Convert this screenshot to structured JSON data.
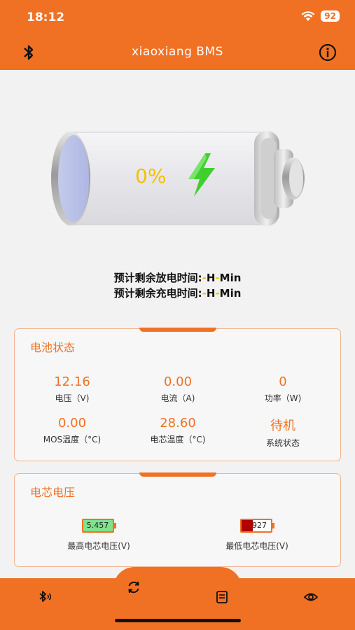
{
  "status": {
    "time": "18:12",
    "battery": "92"
  },
  "header": {
    "title": "xiaoxiang BMS",
    "bt_icon": "bluetooth-icon",
    "info_icon": "info-icon"
  },
  "battery": {
    "percent": "0%",
    "bolt_icon": "lightning-bolt-icon"
  },
  "remaining": {
    "discharge_label": "预计剩余放电时间:",
    "charge_label": "预计剩余充电时间:",
    "h": "H",
    "min": "Min",
    "dash": "-"
  },
  "status_card": {
    "title": "电池状态",
    "items": [
      {
        "value": "12.16",
        "label": "电压（V)"
      },
      {
        "value": "0.00",
        "label": "电流（A)"
      },
      {
        "value": "0",
        "label": "功率（W)"
      },
      {
        "value": "0.00",
        "label": "MOS温度（°C)"
      },
      {
        "value": "28.60",
        "label": "电芯温度（°C)"
      },
      {
        "value": "待机",
        "label": "系统状态"
      }
    ]
  },
  "cell_card": {
    "title": "电芯电压",
    "max": {
      "value": "5.457",
      "label": "最高电芯电压(V)",
      "color": "#7fe28c"
    },
    "min": {
      "value": "927",
      "label": "最低电芯电压(V)",
      "color": "#b00000"
    }
  },
  "nav": {
    "items": [
      "bluetooth-icon",
      "refresh-icon",
      "document-icon",
      "eye-icon"
    ]
  },
  "colors": {
    "accent": "#f07124",
    "percent": "#f5c000",
    "bolt": "#3fcf2e"
  }
}
